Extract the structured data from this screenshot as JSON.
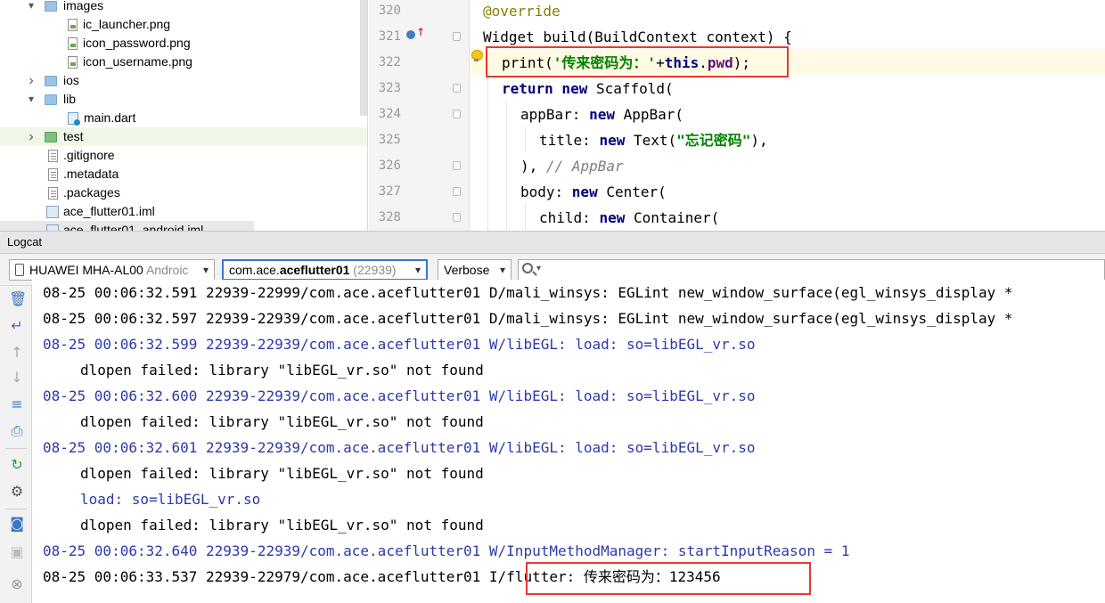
{
  "project_tree": {
    "items": [
      {
        "label": "images",
        "expander": "▾",
        "icon": "folder-icon"
      },
      {
        "label": "ic_launcher.png",
        "icon": "image-file-icon"
      },
      {
        "label": "icon_password.png",
        "icon": "image-file-icon"
      },
      {
        "label": "icon_username.png",
        "icon": "image-file-icon"
      },
      {
        "label": "ios",
        "expander": "›",
        "icon": "folder-icon"
      },
      {
        "label": "lib",
        "expander": "▾",
        "icon": "folder-icon"
      },
      {
        "label": "main.dart",
        "icon": "dart-file-icon"
      },
      {
        "label": "test",
        "expander": "›",
        "icon": "test-folder-icon"
      },
      {
        "label": ".gitignore",
        "icon": "text-file-icon"
      },
      {
        "label": ".metadata",
        "icon": "text-file-icon"
      },
      {
        "label": ".packages",
        "icon": "text-file-icon"
      },
      {
        "label": "ace_flutter01.iml",
        "icon": "module-file-icon"
      },
      {
        "label": "ace_flutter01_android.iml",
        "icon": "module-file-icon"
      }
    ]
  },
  "editor": {
    "line_numbers": [
      "320",
      "321",
      "322",
      "323",
      "324",
      "325",
      "326",
      "327",
      "328"
    ],
    "lines": [
      {
        "annotation": "@override"
      },
      {
        "plain1": "Widget build(BuildContext context) {"
      },
      {
        "plain1": "print(",
        "str": "'传来密码为：'",
        "plain2": "+",
        "kw": "this",
        "plain3": ".",
        "field": "pwd",
        "plain4": ");"
      },
      {
        "kw": "return new",
        "plain1": " Scaffold("
      },
      {
        "plain1": "appBar: ",
        "kw": "new",
        "plain2": " AppBar("
      },
      {
        "plain1": "title: ",
        "kw": "new",
        "plain2": " Text(",
        "str": "\"忘记密码\"",
        "plain3": "),"
      },
      {
        "plain1": "), ",
        "comment": "// AppBar"
      },
      {
        "plain1": "body: ",
        "kw": "new",
        "plain2": " Center("
      },
      {
        "plain1": "child: ",
        "kw": "new",
        "plain2": " Container("
      }
    ]
  },
  "logcat": {
    "title": "Logcat",
    "device": {
      "name": "HUAWEI MHA-AL00",
      "suffix": " Androic",
      "arrow": "▾"
    },
    "process": {
      "prefix": "com.ace.",
      "bold": "aceflutter01",
      "pid": " (22939)",
      "arrow": "▾"
    },
    "level": {
      "value": "Verbose",
      "arrow": "▾"
    },
    "search": {
      "placeholder": "",
      "caret": "▾"
    },
    "lines": [
      {
        "text": "08-25 00:06:32.591 22939-22999/com.ace.aceflutter01 D/mali_winsys: EGLint new_window_surface(egl_winsys_display *",
        "level": "D",
        "continuation": false
      },
      {
        "text": "08-25 00:06:32.597 22939-22939/com.ace.aceflutter01 D/mali_winsys: EGLint new_window_surface(egl_winsys_display *",
        "level": "D",
        "continuation": false
      },
      {
        "text": "08-25 00:06:32.599 22939-22939/com.ace.aceflutter01 W/libEGL: load: so=libEGL_vr.so",
        "level": "W",
        "continuation": false
      },
      {
        "text": "dlopen failed: library \"libEGL_vr.so\" not found",
        "level": "D",
        "continuation": true
      },
      {
        "text": "08-25 00:06:32.600 22939-22939/com.ace.aceflutter01 W/libEGL: load: so=libEGL_vr.so",
        "level": "W",
        "continuation": false
      },
      {
        "text": "dlopen failed: library \"libEGL_vr.so\" not found",
        "level": "D",
        "continuation": true
      },
      {
        "text": "08-25 00:06:32.601 22939-22939/com.ace.aceflutter01 W/libEGL: load: so=libEGL_vr.so",
        "level": "W",
        "continuation": false
      },
      {
        "text": "dlopen failed: library \"libEGL_vr.so\" not found",
        "level": "D",
        "continuation": true
      },
      {
        "text": "load: so=libEGL_vr.so",
        "level": "W",
        "continuation": true
      },
      {
        "text": "dlopen failed: library \"libEGL_vr.so\" not found",
        "level": "D",
        "continuation": true
      },
      {
        "text": "08-25 00:06:32.640 22939-22939/com.ace.aceflutter01 W/InputMethodManager: startInputReason = 1",
        "level": "W",
        "continuation": false
      },
      {
        "text": "08-25 00:06:33.537 22939-22979/com.ace.aceflutter01 I/flutter: 传来密码为：123456",
        "level": "I",
        "continuation": false
      }
    ]
  },
  "colors": {
    "keyword": "#000080",
    "string": "#008000",
    "annotation": "#808000",
    "comment": "#808080",
    "field": "#660e7a",
    "warn_log": "#2d3aa8",
    "highlight_box": "#e53935",
    "caret_line": "#fffae3",
    "selected_combo_border": "#3875d7"
  }
}
